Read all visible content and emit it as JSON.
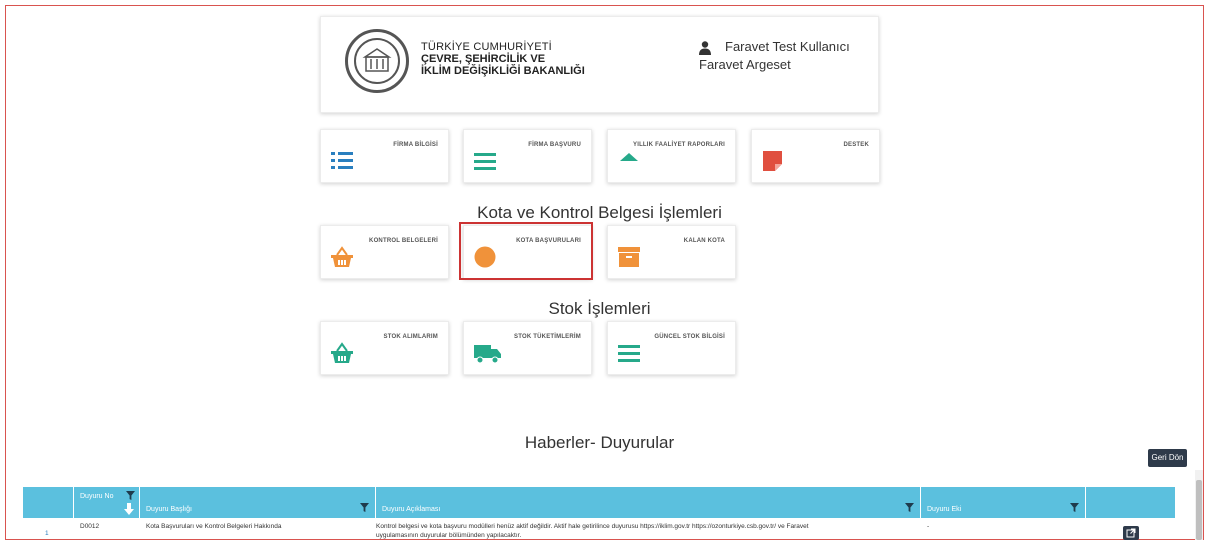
{
  "header": {
    "ministry_line1": "TÜRKİYE CUMHURİYETİ",
    "ministry_line2": "ÇEVRE, ŞEHİRCİLİK VE",
    "ministry_line3": "İKLİM DEĞİŞİKLİĞİ BAKANLIĞI",
    "user_name": "Faravet Test Kullanıcı",
    "user_org": "Faravet Argeset"
  },
  "tiles_main": [
    {
      "label": "FİRMA BİLGİSİ",
      "icon": "list-icon"
    },
    {
      "label": "FİRMA BAŞVURU",
      "icon": "bars-icon"
    },
    {
      "label": "YILLIK FAALİYET RAPORLARI",
      "icon": "triangle-icon"
    },
    {
      "label": "DESTEK",
      "icon": "note-icon"
    }
  ],
  "section_kota": {
    "title": "Kota ve Kontrol Belgesi İşlemleri",
    "tiles": [
      {
        "label": "KONTROL BELGELERİ",
        "icon": "basket-icon"
      },
      {
        "label": "KOTA BAŞVURULARI",
        "icon": "circle-icon"
      },
      {
        "label": "KALAN KOTA",
        "icon": "archive-icon"
      }
    ]
  },
  "section_stok": {
    "title": "Stok İşlemleri",
    "tiles": [
      {
        "label": "STOK ALIMLARIM",
        "icon": "basket-icon"
      },
      {
        "label": "STOK TÜKETİMLERİM",
        "icon": "truck-icon"
      },
      {
        "label": "GÜNCEL STOK BİLGİSİ",
        "icon": "bars-icon"
      }
    ]
  },
  "news": {
    "title": "Haberler- Duyurular",
    "back_button": "Geri Dön",
    "columns": [
      "Duyuru No",
      "Duyuru Başlığı",
      "Duyuru Açıklaması",
      "Duyuru Eki"
    ],
    "rows": [
      {
        "index": "1",
        "no": "D0012",
        "title": "Kota Başvuruları ve Kontrol Belgeleri Hakkında",
        "desc_line1": "Kontrol belgesi ve kota başvuru modülleri henüz aktif değildir. Aktif hale getirilince duyurusu https://iklim.gov.tr  https://ozonturkiye.csb.gov.tr/ ve Faravet",
        "desc_line2": "uygulamasının duyurular bölümünden yapılacaktır.",
        "attachment": "-"
      }
    ]
  },
  "colors": {
    "primary_blue": "#2a7fbf",
    "accent_green": "#26a98a",
    "accent_orange": "#f0923a",
    "accent_red": "#e04f3f",
    "table_header": "#5bc0de",
    "highlight_border": "#cc3333"
  }
}
